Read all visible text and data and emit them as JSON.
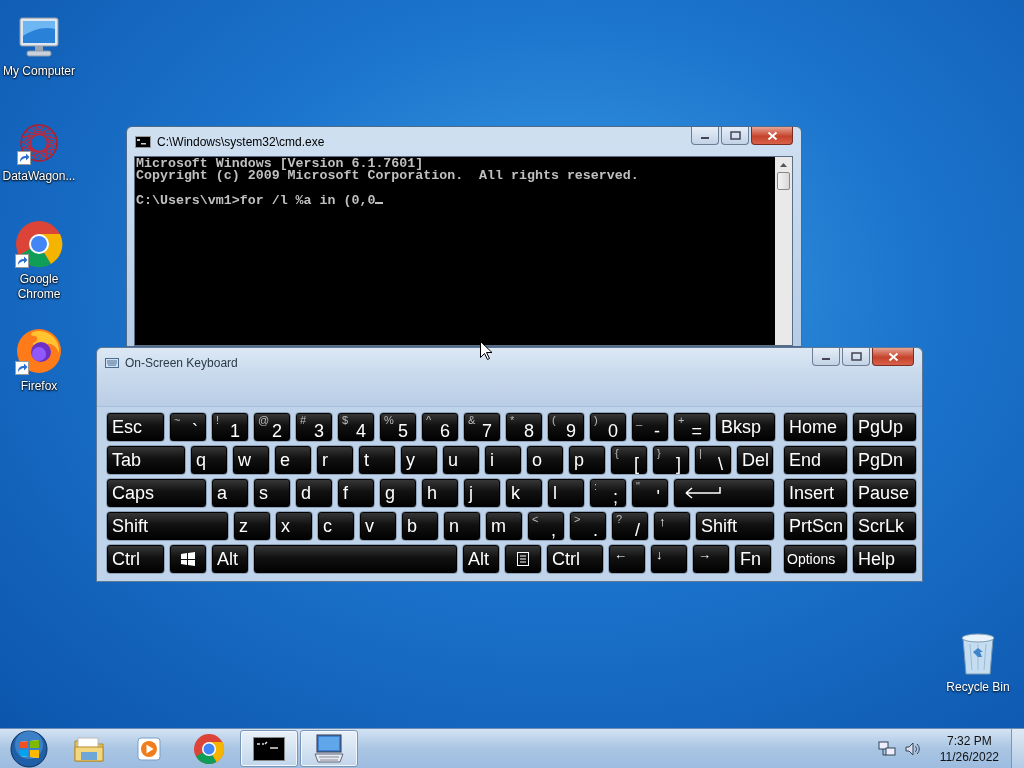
{
  "desktop_icons": [
    {
      "label": "My Computer",
      "kind": "computer",
      "shortcut": false
    },
    {
      "label": "DataWagon...",
      "kind": "network",
      "shortcut": true
    },
    {
      "label": "Google Chrome",
      "kind": "chrome",
      "shortcut": true
    },
    {
      "label": "Firefox",
      "kind": "firefox",
      "shortcut": true
    }
  ],
  "recycle_bin": {
    "label": "Recycle Bin"
  },
  "cmd_window": {
    "title": "C:\\Windows\\system32\\cmd.exe",
    "output": [
      "Microsoft Windows [Version 6.1.7601]",
      "Copyright (c) 2009 Microsoft Corporation.  All rights reserved."
    ],
    "prompt": "C:\\Users\\vm1>for /l %a in (0,0"
  },
  "keyboard_window": {
    "title": "On-Screen Keyboard",
    "rows": [
      {
        "keys": [
          {
            "kind": "label",
            "label": "Esc"
          },
          {
            "kind": "dual",
            "shift": "~",
            "main": "`"
          },
          {
            "kind": "dual",
            "shift": "!",
            "main": "1"
          },
          {
            "kind": "dual",
            "shift": "@",
            "main": "2"
          },
          {
            "kind": "dual",
            "shift": "#",
            "main": "3"
          },
          {
            "kind": "dual",
            "shift": "$",
            "main": "4"
          },
          {
            "kind": "dual",
            "shift": "%",
            "main": "5"
          },
          {
            "kind": "dual",
            "shift": "^",
            "main": "6"
          },
          {
            "kind": "dual",
            "shift": "&",
            "main": "7"
          },
          {
            "kind": "dual",
            "shift": "*",
            "main": "8"
          },
          {
            "kind": "dual",
            "shift": "(",
            "main": "9"
          },
          {
            "kind": "dual",
            "shift": ")",
            "main": "0"
          },
          {
            "kind": "dual",
            "shift": "_",
            "main": "-"
          },
          {
            "kind": "dual",
            "shift": "+",
            "main": "="
          },
          {
            "kind": "label",
            "label": "Bksp"
          }
        ]
      },
      {
        "keys": [
          {
            "kind": "label",
            "label": "Tab"
          },
          {
            "kind": "label",
            "label": "q"
          },
          {
            "kind": "label",
            "label": "w"
          },
          {
            "kind": "label",
            "label": "e"
          },
          {
            "kind": "label",
            "label": "r"
          },
          {
            "kind": "label",
            "label": "t"
          },
          {
            "kind": "label",
            "label": "y"
          },
          {
            "kind": "label",
            "label": "u"
          },
          {
            "kind": "label",
            "label": "i"
          },
          {
            "kind": "label",
            "label": "o"
          },
          {
            "kind": "label",
            "label": "p"
          },
          {
            "kind": "dual",
            "shift": "{",
            "main": "["
          },
          {
            "kind": "dual",
            "shift": "}",
            "main": "]"
          },
          {
            "kind": "dual",
            "shift": "|",
            "main": "\\"
          },
          {
            "kind": "label",
            "label": "Del"
          }
        ]
      },
      {
        "keys": [
          {
            "kind": "label",
            "label": "Caps"
          },
          {
            "kind": "label",
            "label": "a"
          },
          {
            "kind": "label",
            "label": "s"
          },
          {
            "kind": "label",
            "label": "d"
          },
          {
            "kind": "label",
            "label": "f"
          },
          {
            "kind": "label",
            "label": "g"
          },
          {
            "kind": "label",
            "label": "h"
          },
          {
            "kind": "label",
            "label": "j"
          },
          {
            "kind": "label",
            "label": "k"
          },
          {
            "kind": "label",
            "label": "l"
          },
          {
            "kind": "dual",
            "shift": ":",
            "main": ";"
          },
          {
            "kind": "dual",
            "shift": "\"",
            "main": "'"
          },
          {
            "kind": "enter"
          }
        ]
      },
      {
        "keys": [
          {
            "kind": "label",
            "label": "Shift"
          },
          {
            "kind": "label",
            "label": "z"
          },
          {
            "kind": "label",
            "label": "x"
          },
          {
            "kind": "label",
            "label": "c"
          },
          {
            "kind": "label",
            "label": "v"
          },
          {
            "kind": "label",
            "label": "b"
          },
          {
            "kind": "label",
            "label": "n"
          },
          {
            "kind": "label",
            "label": "m"
          },
          {
            "kind": "dual",
            "shift": "<",
            "main": ","
          },
          {
            "kind": "dual",
            "shift": ">",
            "main": "."
          },
          {
            "kind": "dual",
            "shift": "?",
            "main": "/"
          },
          {
            "kind": "corner",
            "label": "↑"
          },
          {
            "kind": "label",
            "label": "Shift"
          }
        ]
      },
      {
        "keys": [
          {
            "kind": "label",
            "label": "Ctrl"
          },
          {
            "kind": "windows"
          },
          {
            "kind": "label",
            "label": "Alt"
          },
          {
            "kind": "space"
          },
          {
            "kind": "label",
            "label": "Alt"
          },
          {
            "kind": "menu"
          },
          {
            "kind": "label",
            "label": "Ctrl"
          },
          {
            "kind": "corner",
            "label": "←"
          },
          {
            "kind": "corner",
            "label": "↓"
          },
          {
            "kind": "corner",
            "label": "→"
          },
          {
            "kind": "label",
            "label": "Fn"
          }
        ]
      }
    ],
    "nav_rows": [
      {
        "keys": [
          {
            "kind": "label",
            "label": "Home"
          },
          {
            "kind": "label",
            "label": "PgUp"
          }
        ]
      },
      {
        "keys": [
          {
            "kind": "label",
            "label": "End"
          },
          {
            "kind": "label",
            "label": "PgDn"
          }
        ]
      },
      {
        "keys": [
          {
            "kind": "label",
            "label": "Insert"
          },
          {
            "kind": "label",
            "label": "Pause"
          }
        ]
      },
      {
        "keys": [
          {
            "kind": "label",
            "label": "PrtScn"
          },
          {
            "kind": "label",
            "label": "ScrLk"
          }
        ]
      },
      {
        "keys": [
          {
            "kind": "small",
            "label": "Options"
          },
          {
            "kind": "label",
            "label": "Help"
          }
        ]
      }
    ]
  },
  "taskbar": {
    "items": [
      {
        "kind": "explorer",
        "selected": false
      },
      {
        "kind": "media",
        "selected": false
      },
      {
        "kind": "chrome",
        "selected": false
      },
      {
        "kind": "cmd",
        "selected": true
      },
      {
        "kind": "keyboard",
        "selected": true
      }
    ],
    "clock": {
      "time": "7:32 PM",
      "date": "11/26/2022"
    }
  }
}
